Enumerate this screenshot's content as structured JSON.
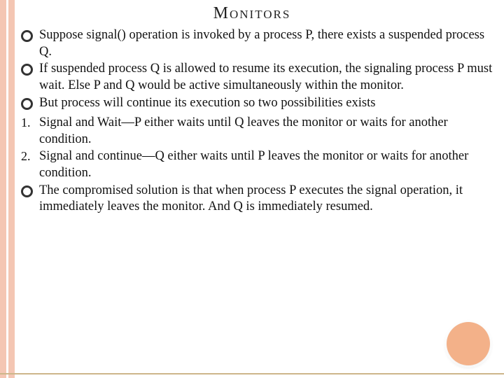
{
  "title": "Monitors",
  "items": [
    {
      "marker": "circle",
      "text": "Suppose signal() operation is invoked by a process P, there exists a suspended process Q."
    },
    {
      "marker": "circle",
      "text": "If suspended process Q is allowed to resume its execution, the signaling process P must wait. Else P and Q would be active simultaneously within the monitor."
    },
    {
      "marker": "circle",
      "text": "But process will continue its execution so two possibilities exists"
    },
    {
      "marker": "1.",
      "text": "Signal and Wait—P either waits until Q leaves the monitor or waits for another condition."
    },
    {
      "marker": "2.",
      "text": "Signal and continue—Q either waits until P leaves the monitor or waits for another condition."
    },
    {
      "marker": "circle",
      "text": "The compromised solution is that when process P executes the signal operation, it immediately leaves the monitor. And Q is immediately resumed."
    }
  ]
}
